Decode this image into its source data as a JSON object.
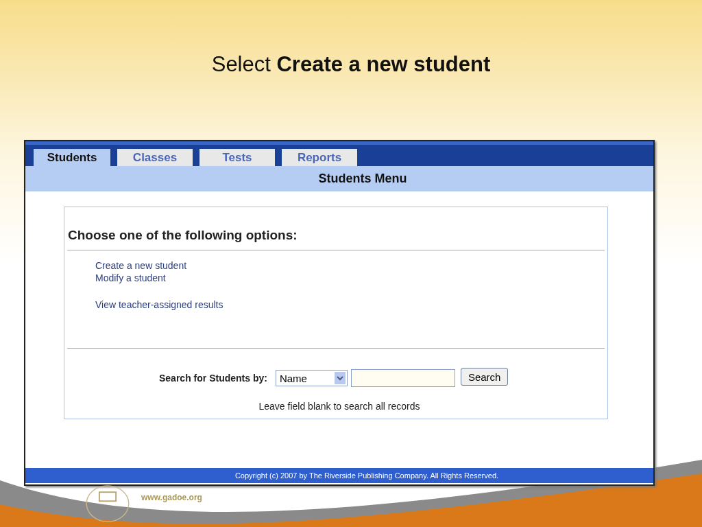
{
  "slide_title": "Select **Create a new student**",
  "tabs": [
    {
      "label": "Students",
      "selected": true
    },
    {
      "label": "Classes",
      "selected": false
    },
    {
      "label": "Tests",
      "selected": false
    },
    {
      "label": "Reports",
      "selected": false
    }
  ],
  "menu_title": "Students Menu",
  "options_heading": "Choose one of the following options:",
  "option_groups": [
    [
      "Create a new student",
      "Modify a student"
    ],
    [
      "View teacher-assigned results"
    ]
  ],
  "search": {
    "label": "Search for Students by:",
    "select_value": "Name",
    "button": "Search",
    "hint": "Leave field blank to search all records"
  },
  "footer": "Copyright (c) 2007 by The Riverside Publishing Company. All Rights Reserved.",
  "slide_footer": {
    "url": "www.gadoe.org"
  }
}
